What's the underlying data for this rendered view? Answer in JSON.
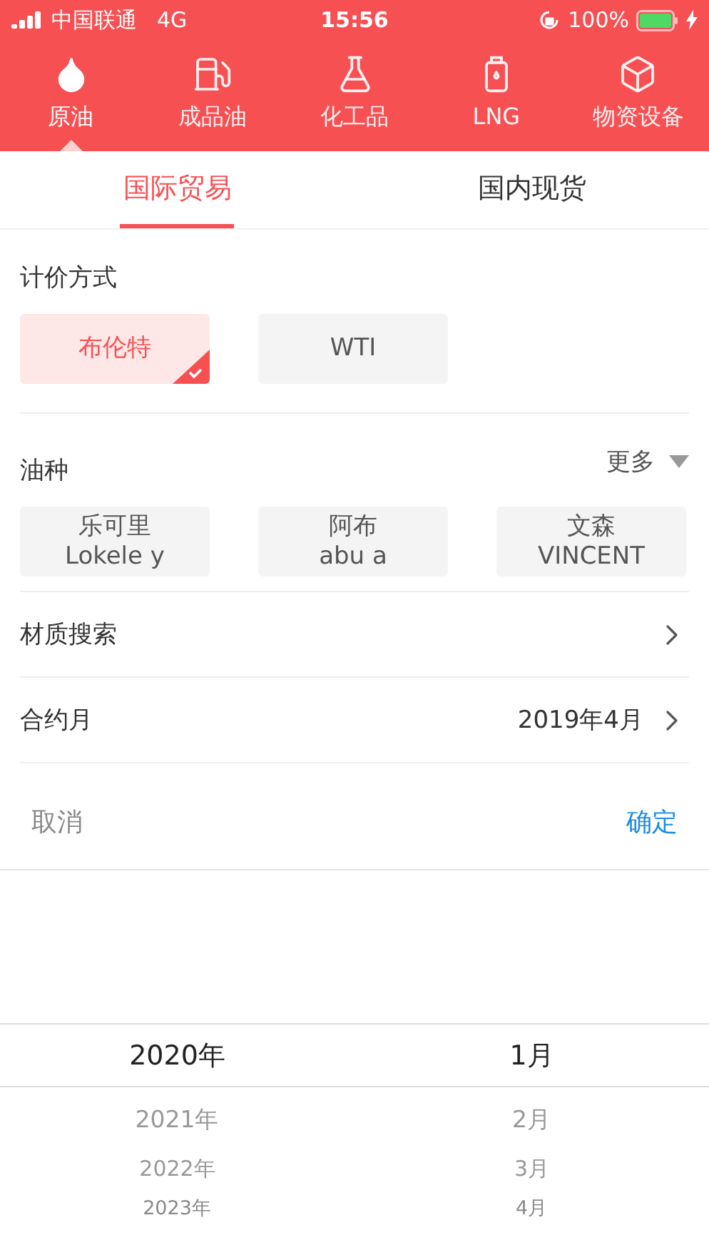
{
  "status_bar": {
    "carrier": "中国联通",
    "network": "4G",
    "time": "15:56",
    "battery": "100%"
  },
  "categories": [
    {
      "label": "原油",
      "kind": "drop",
      "selected": true
    },
    {
      "label": "成品油",
      "kind": "pump",
      "selected": false
    },
    {
      "label": "化工品",
      "kind": "flask",
      "selected": false
    },
    {
      "label": "LNG",
      "kind": "bottle",
      "selected": false
    },
    {
      "label": "物资设备",
      "kind": "box",
      "selected": false
    }
  ],
  "tabs": [
    {
      "label": "国际贸易",
      "selected": true
    },
    {
      "label": "国内现货",
      "selected": false
    }
  ],
  "pricing": {
    "title": "计价方式",
    "options": [
      {
        "label": "布伦特",
        "selected": true
      },
      {
        "label": "WTI",
        "selected": false
      }
    ]
  },
  "oil_types": {
    "title": "油种",
    "more": "更多",
    "options": [
      {
        "name": "乐可里",
        "code": "Lokele y",
        "selected": false
      },
      {
        "name": "阿布",
        "code": "abu a",
        "selected": false
      },
      {
        "name": "文森",
        "code": "VINCENT",
        "selected": false
      }
    ]
  },
  "rows": [
    {
      "label": "材质搜索"
    },
    {
      "label": "合约月",
      "value": "2019年4月"
    }
  ],
  "actions": {
    "cancel": "取消",
    "confirm": "确定"
  },
  "picker": {
    "columns": [
      {
        "items": [
          {
            "label": "2020年",
            "selected": true
          },
          {
            "label": "2021年",
            "selected": false
          },
          {
            "label": "2022年",
            "selected": false
          },
          {
            "label": "2023年",
            "selected": false
          }
        ]
      },
      {
        "items": [
          {
            "label": "1月",
            "selected": true
          },
          {
            "label": "2月",
            "selected": false
          },
          {
            "label": "3月",
            "selected": false
          },
          {
            "label": "4月",
            "selected": false
          }
        ]
      }
    ]
  }
}
